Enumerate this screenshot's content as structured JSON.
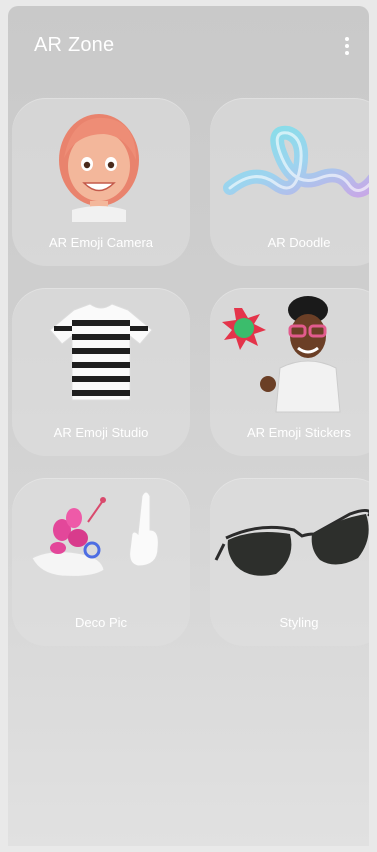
{
  "header": {
    "title": "AR Zone",
    "more_icon": "more-vertical-icon"
  },
  "cards": [
    {
      "label": "AR Emoji Camera",
      "icon": "avatar-face-icon"
    },
    {
      "label": "AR Doodle",
      "icon": "doodle-squiggle-icon"
    },
    {
      "label": "AR Emoji Studio",
      "icon": "striped-tshirt-icon"
    },
    {
      "label": "AR Emoji Stickers",
      "icon": "avatar-sticker-icon"
    },
    {
      "label": "Deco Pic",
      "icon": "balloon-hands-icon"
    },
    {
      "label": "Styling",
      "icon": "sunglasses-icon"
    }
  ],
  "colors": {
    "background": "#cfcfcf",
    "card": "#dedede",
    "text": "#ffffff"
  }
}
